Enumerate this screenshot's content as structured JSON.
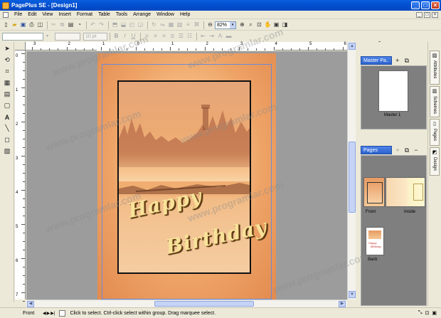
{
  "window": {
    "title": "PagePlus SE - [Design1]",
    "buttons": [
      "_",
      "□",
      "×"
    ]
  },
  "menu": {
    "items": [
      "File",
      "Edit",
      "View",
      "Insert",
      "Format",
      "Table",
      "Tools",
      "Arrange",
      "Window",
      "Help"
    ],
    "mdi_buttons": [
      "_",
      "□",
      "×"
    ]
  },
  "toolbar": {
    "zoom": "82%",
    "font_size": "10 pt",
    "zoom_arrow": "▾"
  },
  "ruler": {
    "h_labels": [
      "3",
      "2",
      "1",
      "0",
      "1",
      "2",
      "3",
      "4",
      "5",
      "6",
      "7"
    ],
    "v_labels": [
      "0",
      "1",
      "2",
      "3",
      "4",
      "5",
      "6",
      "7"
    ]
  },
  "card": {
    "line1": "Happy",
    "line2": "Birthday"
  },
  "panels": {
    "master_tab": "Master Pa..",
    "master_label": "Master 1",
    "pages_tab": "Pages",
    "page_labels": [
      "Front",
      "Inside",
      "Back"
    ],
    "thumb_text": [
      "Happy",
      "Birthday"
    ]
  },
  "side_tabs": [
    "Attributes",
    "Schemes",
    "Pages",
    "Design"
  ],
  "status": {
    "page": "Front",
    "nav": [
      "◀",
      "▶",
      "▶|"
    ],
    "message": "Click to select. Ctrl-click select within group. Drag marquee select."
  },
  "watermark": "www.programlar.com",
  "colors": {
    "titlebar": "#0350d0",
    "panel_tab": "#2e63cc",
    "canvas": "#9c9c9c"
  }
}
